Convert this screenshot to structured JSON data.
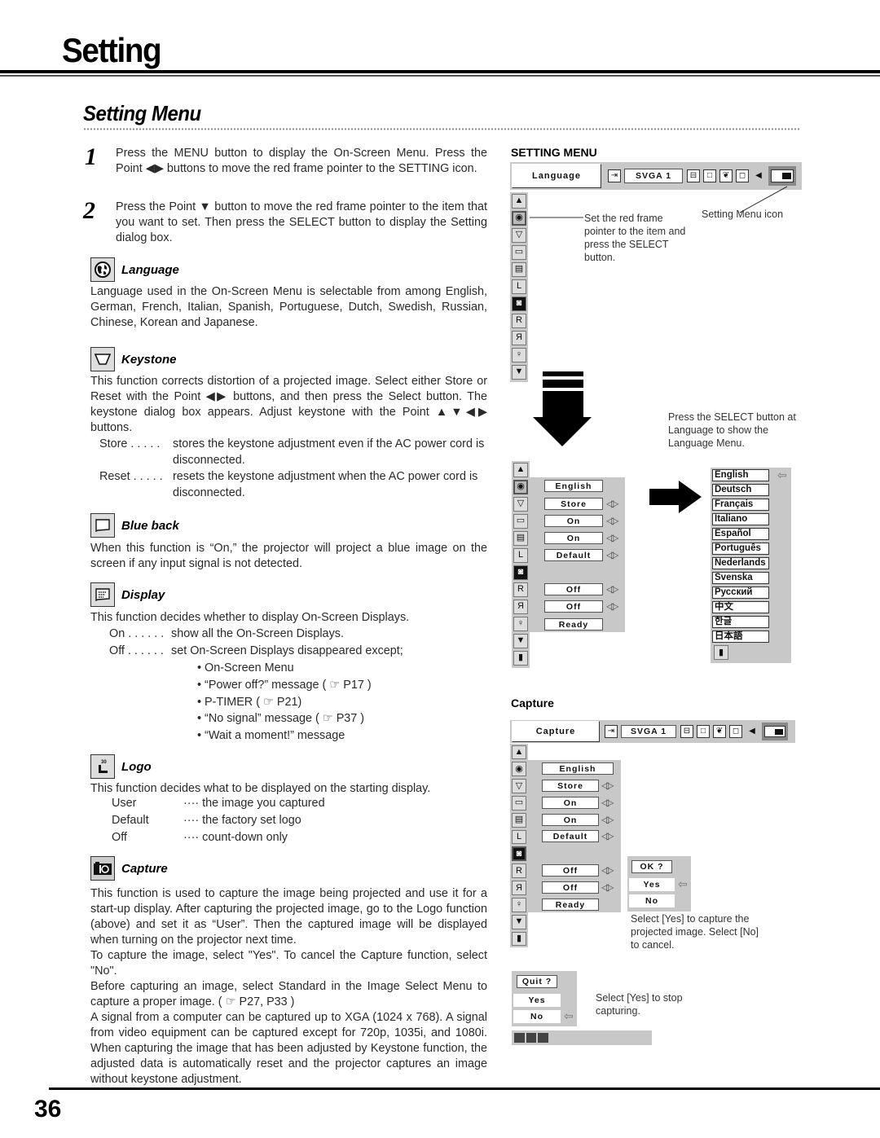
{
  "page": {
    "title": "Setting",
    "section_title": "Setting Menu",
    "page_number": "36"
  },
  "steps": [
    {
      "num": "1",
      "text": "Press the MENU button to display the On-Screen Menu.  Press the Point ◀▶ buttons to move the red frame pointer to the SETTING icon."
    },
    {
      "num": "2",
      "text": "Press the Point ▼ button to move the red frame pointer to the item that you want to set.  Then press the SELECT button to display the Setting dialog box."
    }
  ],
  "sections": {
    "language": {
      "icon": "globe-icon",
      "label": "Language",
      "text": "Language used in the On-Screen Menu is selectable from among English, German, French, Italian, Spanish, Portuguese, Dutch, Swedish, Russian, Chinese, Korean and Japanese."
    },
    "keystone": {
      "icon": "keystone-icon",
      "label": "Keystone",
      "text": "This function corrects distortion of a projected image.  Select either Store or Reset with the Point ◀▶ buttons, and then press the Select button.  The keystone dialog box appears.  Adjust keystone with the Point ▲▼◀▶ buttons.",
      "defs": [
        {
          "term": "Store . . . . .",
          "desc": "stores the keystone adjustment even if the AC power cord is disconnected."
        },
        {
          "term": "Reset . . . . .",
          "desc": "resets the keystone adjustment when the AC power cord is disconnected."
        }
      ]
    },
    "blue_back": {
      "icon": "blue-back-icon",
      "label": "Blue back",
      "text": "When this function is “On,” the projector will project a blue image on the screen if any input signal is not detected."
    },
    "display": {
      "icon": "display-icon",
      "label": "Display",
      "text": "This function decides whether to display On-Screen Displays.",
      "defs": [
        {
          "term": "On . . . . . .",
          "desc": "show all the On-Screen Displays."
        },
        {
          "term": "Off . . . . . .",
          "desc": "set On-Screen Displays disappeared except;"
        }
      ],
      "bullets": [
        "On-Screen Menu",
        "“Power off?” message  ( ☞ P17 )",
        "P-TIMER  ( ☞ P21)",
        "“No signal” message  ( ☞ P37 )",
        "“Wait a moment!” message"
      ]
    },
    "logo": {
      "icon": "logo-icon",
      "label": "Logo",
      "text": "This function decides what to be displayed on the starting display.",
      "defs": [
        {
          "term": "User",
          "desc": "···· the image you captured"
        },
        {
          "term": "Default",
          "desc": "···· the factory set logo"
        },
        {
          "term": "Off",
          "desc": "···· count-down only"
        }
      ]
    },
    "capture": {
      "icon": "camera-icon",
      "label": "Capture",
      "paragraphs": [
        "This function is used to capture the image being projected and use it for a start-up display.  After capturing the projected image, go to the Logo function (above) and set it as “User”.  Then the captured image will be displayed when turning on the projector next time.",
        "To capture the image, select \"Yes\".  To cancel the Capture function, select \"No\".",
        "Before capturing an image, select Standard in the Image Select Menu to capture a proper image.  ( ☞ P27, P33 )",
        "A signal from a computer can be captured up to XGA (1024 x 768).  A signal from video equipment can be captured except for 720p, 1035i, and 1080i.  When capturing the image that has been adjusted by Keystone function, the adjusted data is automatically reset and the projector captures an image without keystone adjustment."
      ]
    }
  },
  "figures": {
    "setting_menu": {
      "heading": "SETTING MENU",
      "tab_label": "Language",
      "source": "SVGA 1",
      "annotation_item": "Set the red frame pointer to the item and press the SELECT button.",
      "annotation_icon": "Setting Menu icon"
    },
    "language_menu_note": "Press the SELECT button at Language to show the Language Menu.",
    "setting_values": [
      "English",
      "Store",
      "On",
      "On",
      "Default",
      "",
      "Off",
      "Off",
      "Ready"
    ],
    "languages": [
      "English",
      "Deutsch",
      "Français",
      "Italiano",
      "Español",
      "Português",
      "Nederlands",
      "Svenska",
      "Русский",
      "中文",
      "한글",
      "日本語"
    ],
    "capture": {
      "heading": "Capture",
      "tab_label": "Capture",
      "source": "SVGA 1",
      "dialog_title": "OK ?",
      "yes": "Yes",
      "no": "No",
      "note": "Select [Yes] to capture the projected image. Select [No] to cancel."
    },
    "quit": {
      "title": "Quit ?",
      "yes": "Yes",
      "no": "No",
      "note": "Select [Yes] to stop capturing.",
      "progress_fraction": 0.25
    }
  }
}
